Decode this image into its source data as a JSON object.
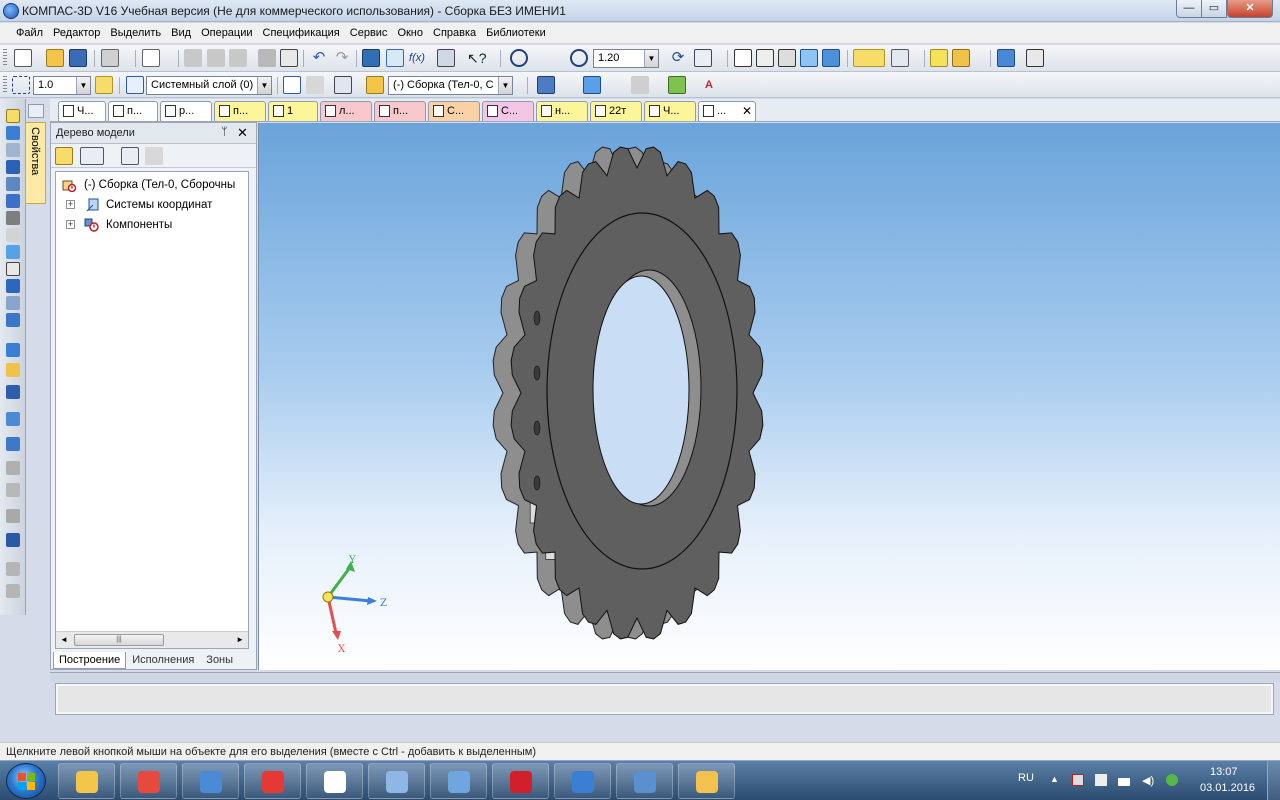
{
  "window": {
    "title": "КОМПАС-3D V16 Учебная версия  (Не для коммерческого использования) - Сборка БЕЗ ИМЕНИ1",
    "min_glyph": "—",
    "max_glyph": "▭",
    "close_glyph": "✕"
  },
  "menu": [
    "Файл",
    "Редактор",
    "Выделить",
    "Вид",
    "Операции",
    "Спецификация",
    "Сервис",
    "Окно",
    "Справка",
    "Библиотеки"
  ],
  "toolbar": {
    "zoom_value": "1.20",
    "step_value": "1.0",
    "layer_value": "Системный слой (0)",
    "assembly_value": "(-) Сборка (Тел-0, С"
  },
  "tabs": [
    {
      "label": "Ч...",
      "color": "#ffffff"
    },
    {
      "label": "п...",
      "color": "#ffffff"
    },
    {
      "label": "р...",
      "color": "#ffffff"
    },
    {
      "label": "п...",
      "color": "#fdf59a"
    },
    {
      "label": "1",
      "color": "#fdf59a"
    },
    {
      "label": "л...",
      "color": "#f8c8cc"
    },
    {
      "label": "п...",
      "color": "#f8c8cc"
    },
    {
      "label": "С...",
      "color": "#fbd2a8"
    },
    {
      "label": "С...",
      "color": "#f4c6e6"
    },
    {
      "label": "н...",
      "color": "#fdf59a"
    },
    {
      "label": "22т",
      "color": "#fdf59a"
    },
    {
      "label": "Ч...",
      "color": "#fdf59a"
    },
    {
      "label": "...",
      "color": "#ffffff"
    }
  ],
  "side_tab_label": "Свойства",
  "tree": {
    "title": "Дерево модели",
    "pin_glyph": "ᛘ",
    "close_glyph": "✕",
    "root": "(-) Сборка (Тел-0, Сборочны",
    "children": [
      "Системы координат",
      "Компоненты"
    ],
    "expander_glyph": "+",
    "bottom_tabs": [
      "Построение",
      "Исполнения",
      "Зоны"
    ],
    "scroll_thumb": "|||",
    "scroll_left": "◄",
    "scroll_right": "►"
  },
  "axes": {
    "x": "X",
    "y": "Y",
    "z": "Z"
  },
  "status_text": "Щелкните левой кнопкой мыши на объекте для его выделения (вместе с Ctrl - добавить к выделенным)",
  "taskbar": {
    "apps": [
      "explorer-icon",
      "chrome-icon",
      "volume-app-icon",
      "yandex-icon",
      "yandex-browser-icon",
      "calculator-icon",
      "image-viewer-icon",
      "opera-icon",
      "kompas-icon",
      "control-panel-icon",
      "paint-icon"
    ],
    "lang": "RU",
    "time": "13:07",
    "date": "03.01.2016"
  },
  "colors": {
    "gear_face": "#5f5f5f",
    "gear_dark": "#3a3a3a",
    "gear_rim": "#8e8e8e",
    "gear_light": "#dcdcdc",
    "axis_x": "#e05050",
    "axis_y": "#3fb04a",
    "axis_z": "#3c7fe0"
  }
}
